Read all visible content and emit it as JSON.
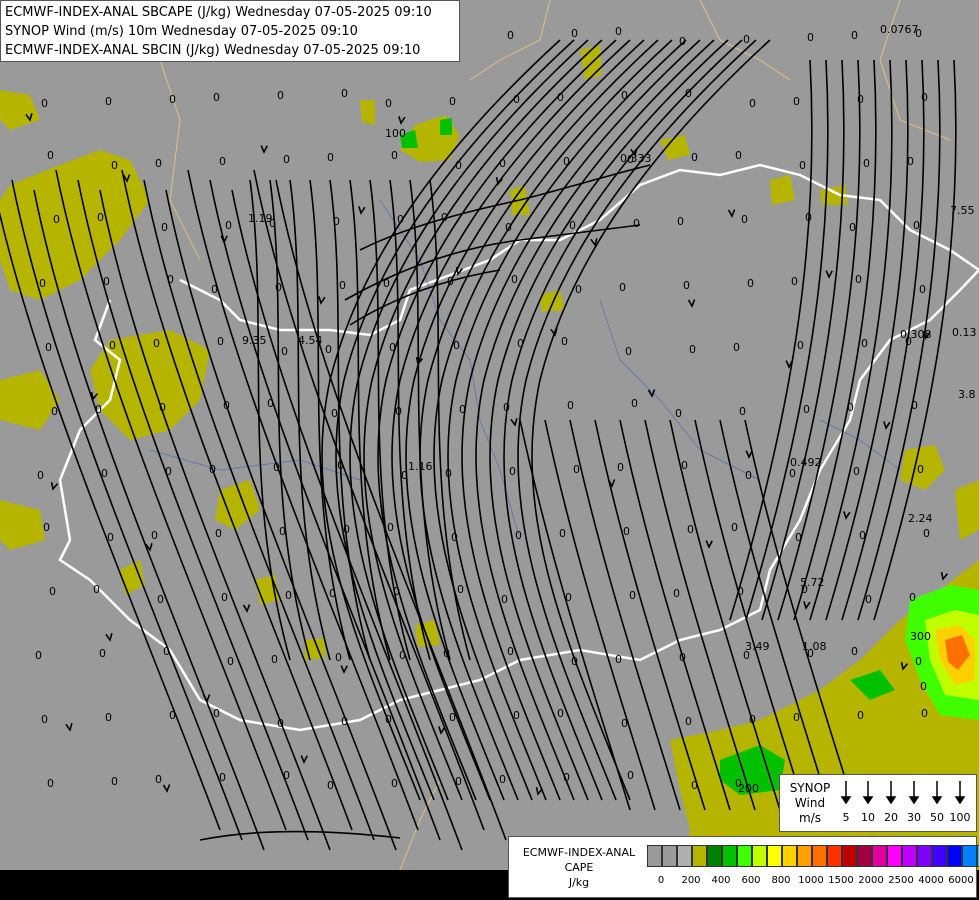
{
  "header": {
    "line1": "ECMWF-INDEX-ANAL SBCAPE (J/kg) Wednesday 07-05-2025 09:10",
    "line2": "SYNOP Wind (m/s) 10m Wednesday 07-05-2025 09:10",
    "line3": "ECMWF-INDEX-ANAL SBCIN (J/kg) Wednesday 07-05-2025 09:10"
  },
  "wind_legend": {
    "title_line1": "SYNOP",
    "title_line2": "Wind",
    "title_line3": "m/s",
    "values": [
      "5",
      "10",
      "20",
      "30",
      "50",
      "100"
    ]
  },
  "cape_legend": {
    "title_line1": "ECMWF-INDEX-ANAL",
    "title_line2": "CAPE",
    "title_line3": "J/kg",
    "colors": [
      "#9a9a9a",
      "#9a9a9a",
      "#b0b0b0",
      "#b5b500",
      "#008000",
      "#00c000",
      "#40ff00",
      "#c0ff00",
      "#ffff00",
      "#ffd000",
      "#ffa000",
      "#ff7000",
      "#ff3000",
      "#c00000",
      "#a00040",
      "#e000a0",
      "#ff00ff",
      "#c000ff",
      "#8000ff",
      "#4000ff",
      "#0000ff",
      "#0080ff",
      "#00e0ff",
      "#80ffff",
      "#ffffff"
    ],
    "ticks": [
      "0",
      "200",
      "400",
      "600",
      "800",
      "1000",
      "1500",
      "2000",
      "2500",
      "4000",
      "6000"
    ]
  },
  "map": {
    "background_color": "#9a9a9a",
    "cape_color": "#b5b500",
    "labels": [
      {
        "text": "0.0767"
      },
      {
        "text": "0.333"
      },
      {
        "text": "1.19"
      },
      {
        "text": "9.35"
      },
      {
        "text": "4.54"
      },
      {
        "text": "1.16"
      },
      {
        "text": "0.492"
      },
      {
        "text": "0.308"
      },
      {
        "text": "0.13"
      },
      {
        "text": "3.8"
      },
      {
        "text": "7.55"
      },
      {
        "text": "2.24"
      },
      {
        "text": "5.72"
      },
      {
        "text": "3.49"
      },
      {
        "text": "1.08"
      },
      {
        "text": "100"
      },
      {
        "text": "200"
      },
      {
        "text": "300"
      },
      {
        "text": "0"
      }
    ]
  }
}
